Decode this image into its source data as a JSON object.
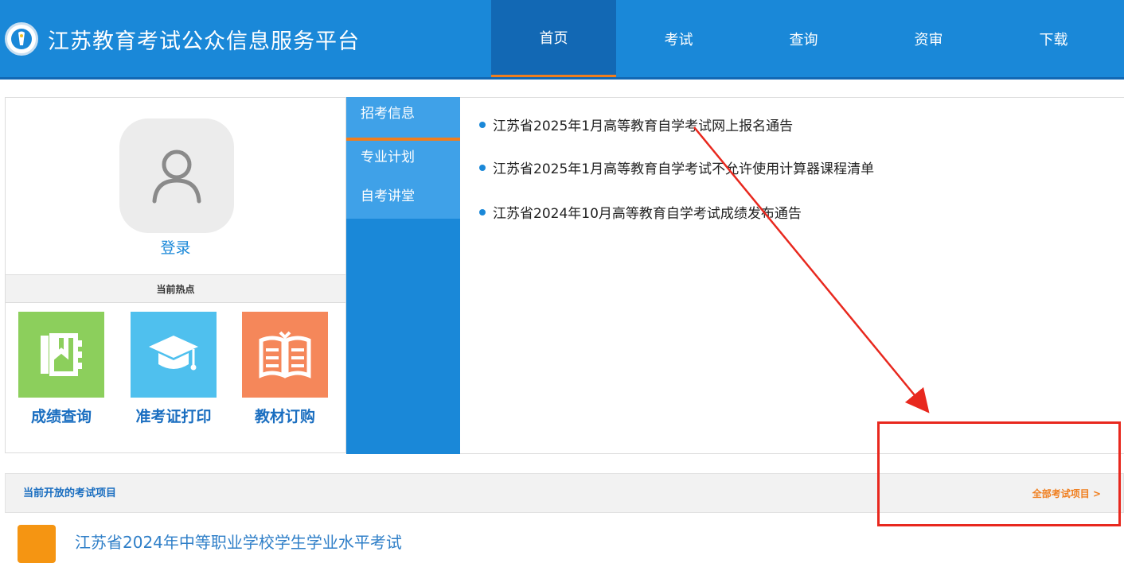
{
  "header": {
    "title": "江苏教育考试公众信息服务平台",
    "nav": [
      {
        "label": "首页",
        "active": true
      },
      {
        "label": "考试",
        "active": false
      },
      {
        "label": "查询",
        "active": false
      },
      {
        "label": "资审",
        "active": false
      },
      {
        "label": "下载",
        "active": false
      }
    ]
  },
  "login": {
    "link": "登录",
    "hot_title": "当前热点",
    "tiles": [
      {
        "label": "成绩查询",
        "color": "#8ccf5c",
        "icon": "notebook-icon"
      },
      {
        "label": "准考证打印",
        "color": "#4fc0ee",
        "icon": "graduation-cap-icon"
      },
      {
        "label": "教材订购",
        "color": "#f5875a",
        "icon": "open-book-icon"
      }
    ]
  },
  "side_tabs": [
    {
      "label": "招考信息",
      "active": true
    },
    {
      "label": "专业计划",
      "active": false
    },
    {
      "label": "自考讲堂",
      "active": false
    }
  ],
  "news": [
    "江苏省2025年1月高等教育自学考试网上报名通告",
    "江苏省2025年1月高等教育自学考试不允许使用计算器课程清单",
    "江苏省2024年10月高等教育自学考试成绩发布通告"
  ],
  "exam_section": {
    "title": "当前开放的考试项目",
    "more": "全部考试项目 >",
    "items": [
      {
        "name": "江苏省2024年中等职业学校学生学业水平考试"
      }
    ]
  },
  "colors": {
    "primary": "#1a88d8",
    "primary_dark": "#1268b4",
    "accent": "#f07e1e",
    "annotation": "#e8281e"
  }
}
